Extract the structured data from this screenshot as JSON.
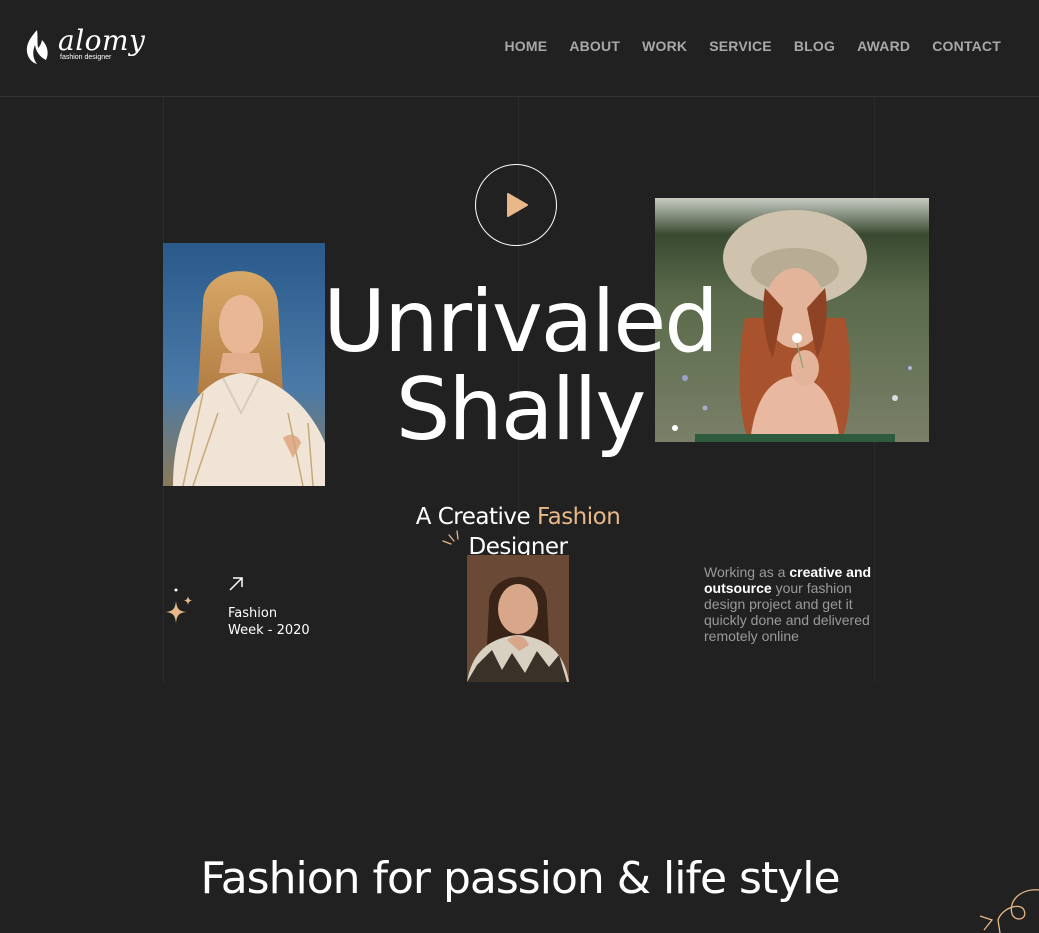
{
  "brand": {
    "name": "alomy",
    "tagline": "fashion designer",
    "logo_icon": "flame-leaf-icon"
  },
  "nav": {
    "items": [
      {
        "label": "HOME"
      },
      {
        "label": "ABOUT"
      },
      {
        "label": "WORK"
      },
      {
        "label": "SERVICE"
      },
      {
        "label": "BLOG"
      },
      {
        "label": "AWARD"
      },
      {
        "label": "CONTACT"
      }
    ]
  },
  "hero": {
    "play_icon": "play-icon",
    "headline_line1": "Unrivaled",
    "headline_line2": "Shally",
    "subtitle_part1": "A Creative ",
    "subtitle_accent": "Fashion",
    "subtitle_part2": "Designer",
    "event_line1": "Fashion",
    "event_line2": "Week - 2020",
    "description_part1": "Working as a ",
    "description_bold": "creative and outsource",
    "description_part2": " your fashion design project and get it quickly done and delivered remotely online"
  },
  "section": {
    "title": "Fashion for passion & life style"
  },
  "colors": {
    "background": "#212121",
    "accent": "#e8b888",
    "nav_text": "#a8a8a8",
    "muted_text": "#9a9a9a"
  }
}
